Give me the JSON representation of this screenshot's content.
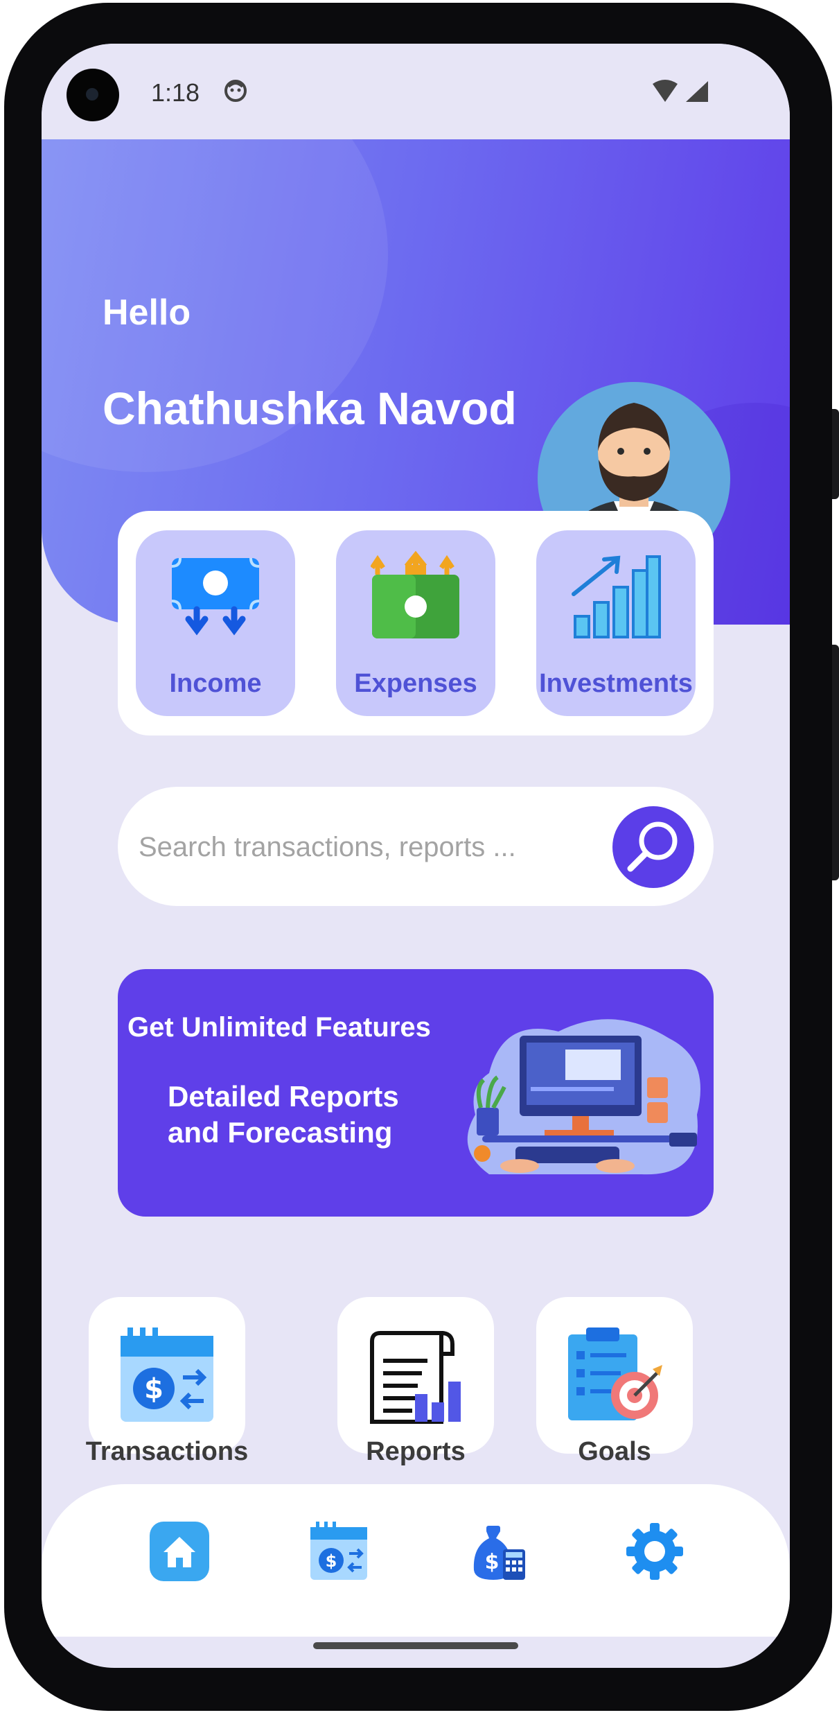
{
  "status_bar": {
    "time": "1:18"
  },
  "header": {
    "greeting": "Hello",
    "user_name": "Chathushka Navod"
  },
  "categories": [
    {
      "label": "Income",
      "icon": "income-icon"
    },
    {
      "label": "Expenses",
      "icon": "expenses-icon"
    },
    {
      "label": "Investments",
      "icon": "investments-icon"
    }
  ],
  "search": {
    "placeholder": "Search transactions, reports ...",
    "value": ""
  },
  "promo": {
    "title": "Get Unlimited Features",
    "subtitle": "Detailed Reports\nand Forecasting"
  },
  "shortcuts": [
    {
      "label": "Transactions",
      "icon": "transactions-icon"
    },
    {
      "label": "Reports",
      "icon": "reports-icon"
    },
    {
      "label": "Goals",
      "icon": "goals-icon"
    }
  ],
  "nav": [
    {
      "icon": "home-icon"
    },
    {
      "icon": "transactions-nav-icon"
    },
    {
      "icon": "budget-calculator-icon"
    },
    {
      "icon": "settings-icon"
    }
  ],
  "colors": {
    "accent": "#5f3fe9",
    "tile_bg": "#c8c8fb",
    "tile_text": "#4f52d6",
    "screen_bg": "#e7e5f6"
  }
}
